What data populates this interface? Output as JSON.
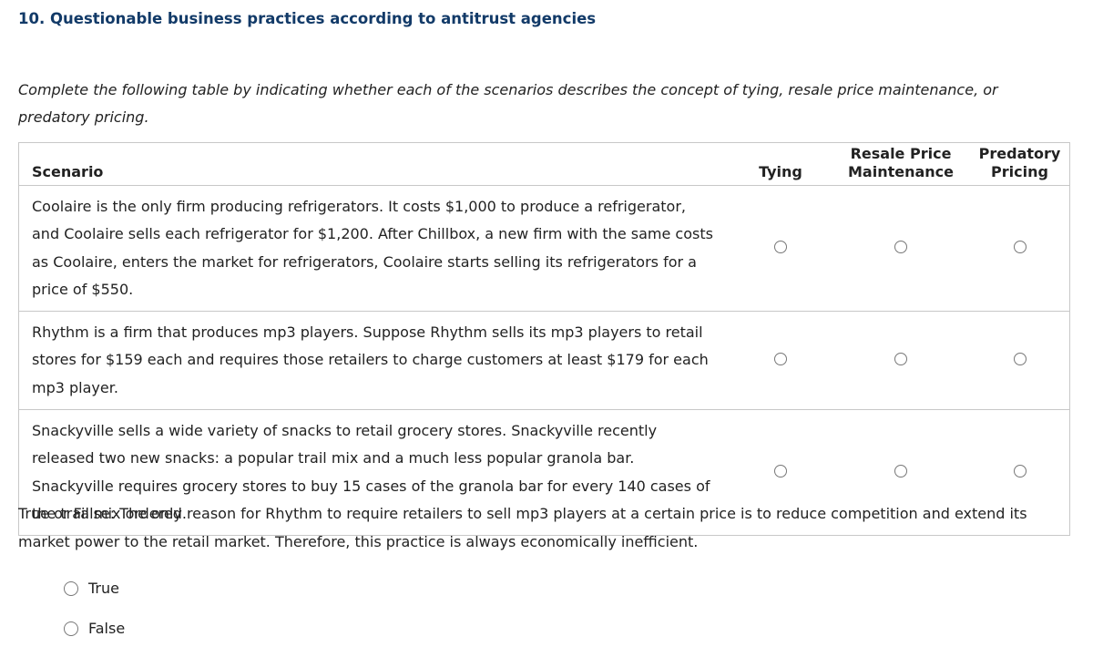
{
  "question": {
    "title": "10. Questionable business practices according to antitrust agencies",
    "instructions": "Complete the following table by indicating whether each of the scenarios describes the concept of tying, resale price maintenance, or predatory pricing."
  },
  "table": {
    "headers": {
      "scenario": "Scenario",
      "tying": "Tying",
      "resale_line1": "Resale Price",
      "resale_line2": "Maintenance",
      "predatory_line1": "Predatory",
      "predatory_line2": "Pricing"
    },
    "rows": [
      {
        "scenario": "Coolaire is the only firm producing refrigerators. It costs $1,000 to produce a refrigerator, and Coolaire sells each refrigerator for $1,200. After Chillbox, a new firm with the same costs as Coolaire, enters the market for refrigerators, Coolaire starts selling its refrigerators for a price of $550.",
        "selected": null
      },
      {
        "scenario": "Rhythm is a firm that produces mp3 players. Suppose Rhythm sells its mp3 players to retail stores for $159 each and requires those retailers to charge customers at least $179 for each mp3 player.",
        "selected": null
      },
      {
        "scenario": "Snackyville sells a wide variety of snacks to retail grocery stores. Snackyville recently released two new snacks: a popular trail mix and a much less popular granola bar. Snackyville requires grocery stores to buy 15 cases of the granola bar for every 140 cases of the trail mix ordered.",
        "selected": null
      }
    ]
  },
  "true_false": {
    "prompt": "True or False: The only reason for Rhythm to require retailers to sell mp3 players at a certain price is to reduce competition and extend its market power to the retail market. Therefore, this practice is always economically inefficient.",
    "options": [
      "True",
      "False"
    ],
    "selected": null
  }
}
